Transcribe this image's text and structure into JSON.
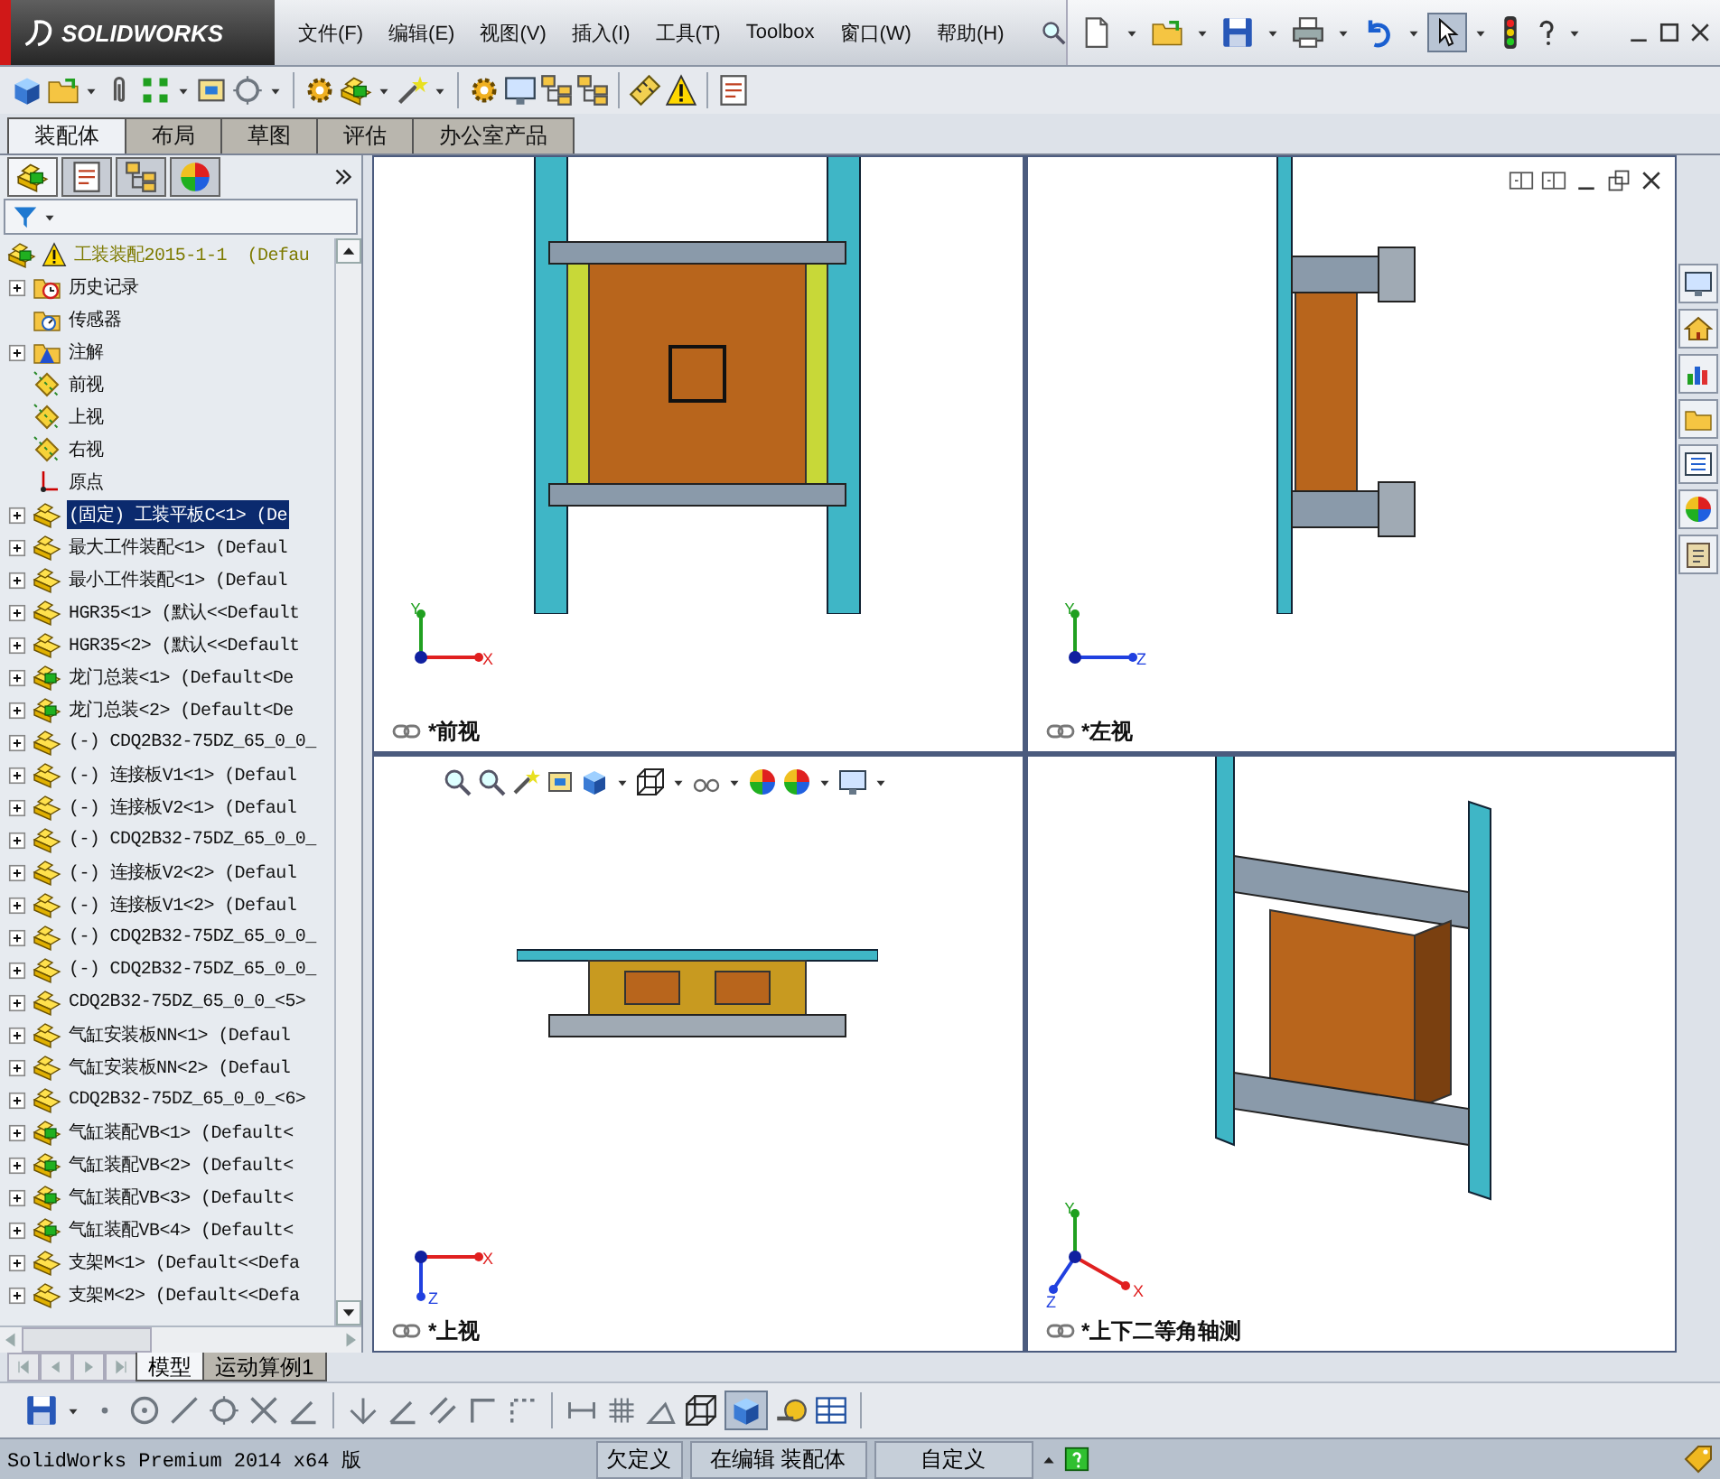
{
  "app": {
    "logo": "SOLIDWORKS",
    "menu": [
      "文件(F)",
      "编辑(E)",
      "视图(V)",
      "插入(I)",
      "工具(T)",
      "Toolbox",
      "窗口(W)",
      "帮助(H)"
    ]
  },
  "command_tabs": [
    {
      "label": "装配体",
      "selected": true
    },
    {
      "label": "布局",
      "selected": false
    },
    {
      "label": "草图",
      "selected": false
    },
    {
      "label": "评估",
      "selected": false
    },
    {
      "label": "办公室产品",
      "selected": false
    }
  ],
  "panel_tabs": [
    {
      "selected": true
    },
    {
      "selected": false
    },
    {
      "selected": false
    },
    {
      "selected": false
    }
  ],
  "tree": {
    "root": {
      "label": "工装装配2015-1-1  (Defau"
    },
    "items": [
      {
        "kind": "history",
        "label": "历史记录",
        "expandable": true,
        "selected": false
      },
      {
        "kind": "sensor",
        "label": "传感器",
        "expandable": false,
        "selected": false
      },
      {
        "kind": "annotation",
        "label": "注解",
        "expandable": true,
        "selected": false
      },
      {
        "kind": "plane",
        "label": "前视",
        "expandable": false,
        "selected": false
      },
      {
        "kind": "plane",
        "label": "上视",
        "expandable": false,
        "selected": false
      },
      {
        "kind": "plane",
        "label": "右视",
        "expandable": false,
        "selected": false
      },
      {
        "kind": "origin",
        "label": "原点",
        "expandable": false,
        "selected": false
      },
      {
        "kind": "part",
        "label": "(固定) 工装平板C<1> (De",
        "expandable": true,
        "selected": true
      },
      {
        "kind": "part",
        "label": "最大工件装配<1> (Defaul",
        "expandable": true,
        "selected": false
      },
      {
        "kind": "part",
        "label": "最小工件装配<1> (Defaul",
        "expandable": true,
        "selected": false
      },
      {
        "kind": "part",
        "label": "HGR35<1> (默认<<Default",
        "expandable": true,
        "selected": false
      },
      {
        "kind": "part",
        "label": "HGR35<2> (默认<<Default",
        "expandable": true,
        "selected": false
      },
      {
        "kind": "assembly",
        "label": "龙门总装<1> (Default<De",
        "expandable": true,
        "selected": false
      },
      {
        "kind": "assembly",
        "label": "龙门总装<2> (Default<De",
        "expandable": true,
        "selected": false
      },
      {
        "kind": "part",
        "label": "(-) CDQ2B32-75DZ_65_0_0_",
        "expandable": true,
        "selected": false
      },
      {
        "kind": "part",
        "label": "(-) 连接板V1<1> (Defaul",
        "expandable": true,
        "selected": false
      },
      {
        "kind": "part",
        "label": "(-) 连接板V2<1> (Defaul",
        "expandable": true,
        "selected": false
      },
      {
        "kind": "part",
        "label": "(-) CDQ2B32-75DZ_65_0_0_",
        "expandable": true,
        "selected": false
      },
      {
        "kind": "part",
        "label": "(-) 连接板V2<2> (Defaul",
        "expandable": true,
        "selected": false
      },
      {
        "kind": "part",
        "label": "(-) 连接板V1<2> (Defaul",
        "expandable": true,
        "selected": false
      },
      {
        "kind": "part",
        "label": "(-) CDQ2B32-75DZ_65_0_0_",
        "expandable": true,
        "selected": false
      },
      {
        "kind": "part",
        "label": "(-) CDQ2B32-75DZ_65_0_0_",
        "expandable": true,
        "selected": false
      },
      {
        "kind": "part",
        "label": "CDQ2B32-75DZ_65_0_0_<5>",
        "expandable": true,
        "selected": false
      },
      {
        "kind": "part",
        "label": "气缸安装板NN<1> (Defaul",
        "expandable": true,
        "selected": false
      },
      {
        "kind": "part",
        "label": "气缸安装板NN<2> (Defaul",
        "expandable": true,
        "selected": false
      },
      {
        "kind": "part",
        "label": "CDQ2B32-75DZ_65_0_0_<6>",
        "expandable": true,
        "selected": false
      },
      {
        "kind": "assembly",
        "label": "气缸装配VB<1> (Default<",
        "expandable": true,
        "selected": false
      },
      {
        "kind": "assembly",
        "label": "气缸装配VB<2> (Default<",
        "expandable": true,
        "selected": false
      },
      {
        "kind": "assembly",
        "label": "气缸装配VB<3> (Default<",
        "expandable": true,
        "selected": false
      },
      {
        "kind": "assembly",
        "label": "气缸装配VB<4> (Default<",
        "expandable": true,
        "selected": false
      },
      {
        "kind": "part",
        "label": "支架M<1> (Default<<Defa",
        "expandable": true,
        "selected": false
      },
      {
        "kind": "part",
        "label": "支架M<2> (Default<<Defa",
        "expandable": true,
        "selected": false
      }
    ]
  },
  "viewports": [
    {
      "label": "*前视",
      "kind": "front",
      "window_controls": false,
      "heads_up_toolbar": false,
      "triad": [
        {
          "label": "Y",
          "kind": "up",
          "color": "#20a020"
        },
        {
          "label": "X",
          "kind": "right",
          "color": "#e02020"
        }
      ]
    },
    {
      "label": "*左视",
      "kind": "left",
      "window_controls": true,
      "heads_up_toolbar": false,
      "triad": [
        {
          "label": "Y",
          "kind": "up",
          "color": "#20a020"
        },
        {
          "label": "Z",
          "kind": "right",
          "color": "#2040e0"
        }
      ]
    },
    {
      "label": "*上视",
      "kind": "top",
      "window_controls": false,
      "heads_up_toolbar": true,
      "triad": [
        {
          "label": "X",
          "kind": "right",
          "color": "#e02020"
        },
        {
          "label": "Z",
          "kind": "down",
          "color": "#2040e0"
        }
      ]
    },
    {
      "label": "*上下二等角轴测",
      "kind": "iso",
      "window_controls": false,
      "heads_up_toolbar": false,
      "triad": [
        {
          "label": "Y",
          "kind": "up",
          "color": "#20a020"
        },
        {
          "label": "X",
          "kind": "rightdown",
          "color": "#e02020"
        },
        {
          "label": "Z",
          "kind": "downleft",
          "color": "#2040e0"
        }
      ]
    }
  ],
  "bottom_tabs": [
    {
      "label": "模型",
      "selected": true
    },
    {
      "label": "运动算例1",
      "selected": false
    }
  ],
  "status_bar": {
    "text": "SolidWorks Premium 2014 x64 版",
    "segments": [
      "欠定义",
      "在编辑 装配体",
      "自定义"
    ]
  }
}
